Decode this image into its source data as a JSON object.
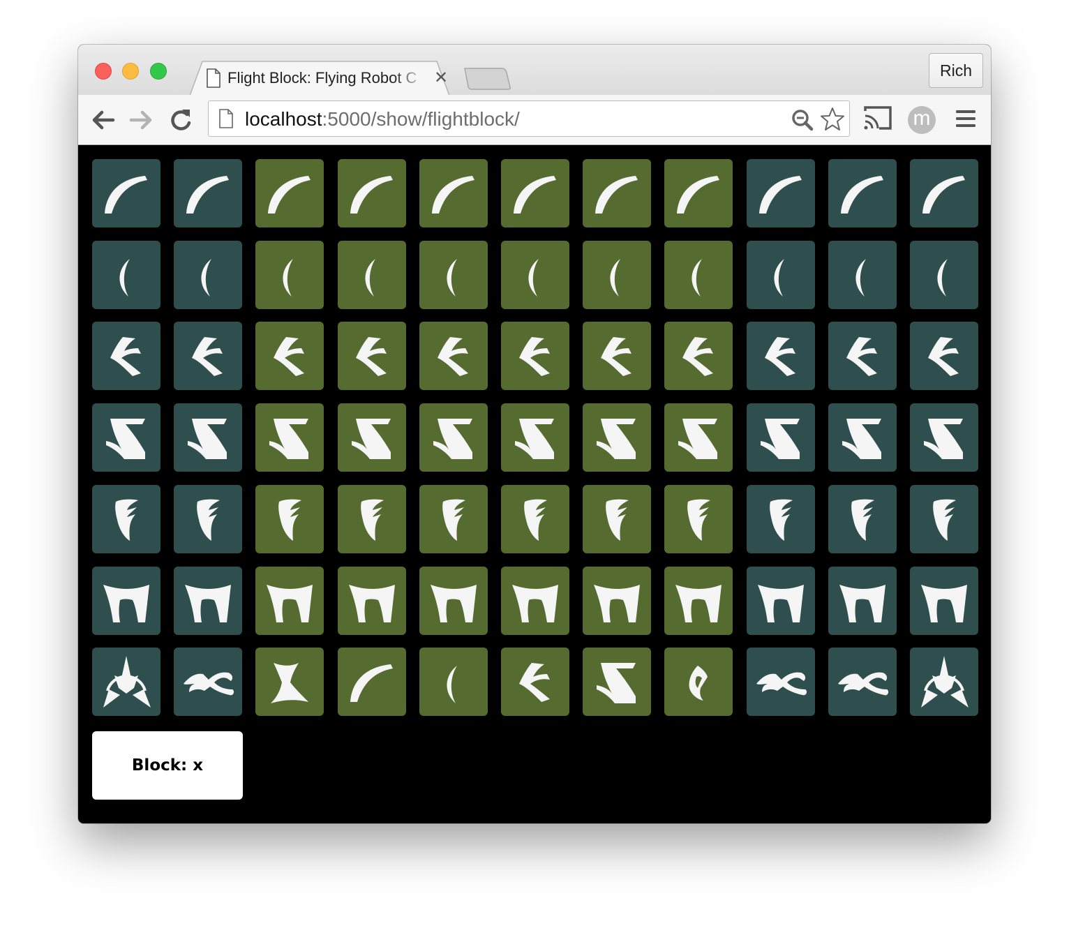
{
  "browser": {
    "tab_title": "Flight Block: Flying Robot C",
    "tab_close": "✕",
    "profile_name": "Rich",
    "avatar_initial": "m",
    "url_host": "localhost",
    "url_path": ":5000/show/flightblock/"
  },
  "colors": {
    "slate": "#2f4f4f",
    "olive": "#556b2f",
    "glyph": "#f5f5f5"
  },
  "grid": {
    "column_colors": [
      "slate",
      "slate",
      "olive",
      "olive",
      "olive",
      "olive",
      "olive",
      "olive",
      "slate",
      "slate",
      "slate"
    ],
    "rows": [
      [
        "arc",
        "arc",
        "arc",
        "arc",
        "arc",
        "arc",
        "arc",
        "arc",
        "arc",
        "arc",
        "arc"
      ],
      [
        "crescent",
        "crescent",
        "crescent",
        "crescent",
        "crescent",
        "crescent",
        "crescent",
        "crescent",
        "crescent",
        "crescent",
        "crescent"
      ],
      [
        "arrow",
        "arrow",
        "arrow",
        "arrow",
        "arrow",
        "arrow",
        "arrow",
        "arrow",
        "arrow",
        "arrow",
        "arrow"
      ],
      [
        "zigzag",
        "zigzag",
        "zigzag",
        "zigzag",
        "zigzag",
        "zigzag",
        "zigzag",
        "zigzag",
        "zigzag",
        "zigzag",
        "zigzag"
      ],
      [
        "f-shape",
        "f-shape",
        "f-shape",
        "f-shape",
        "f-shape",
        "f-shape",
        "f-shape",
        "f-shape",
        "f-shape",
        "f-shape",
        "f-shape"
      ],
      [
        "arch",
        "arch",
        "arch",
        "arch",
        "arch",
        "arch",
        "arch",
        "arch",
        "arch",
        "arch",
        "arch"
      ],
      [
        "klingon-emblem",
        "bird-of-prey",
        "hourglass",
        "arc",
        "crescent",
        "arrow",
        "zigzag",
        "drop",
        "bird-of-prey",
        "bird-of-prey",
        "klingon-emblem"
      ]
    ]
  },
  "block": {
    "label": "Block: x"
  }
}
